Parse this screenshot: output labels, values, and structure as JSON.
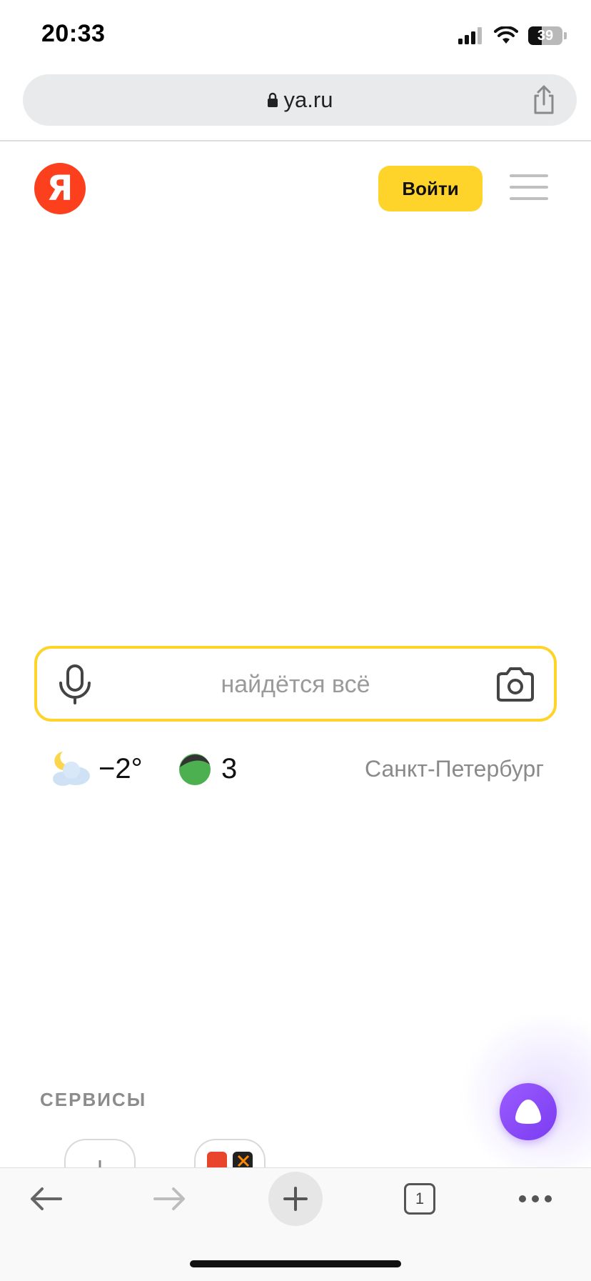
{
  "status_bar": {
    "time": "20:33",
    "battery": "39",
    "battery_level": 0.39
  },
  "address_bar": {
    "url": "ya.ru"
  },
  "header": {
    "logo_letter": "Я",
    "login_label": "Войти"
  },
  "search": {
    "placeholder": "найдётся всё"
  },
  "info": {
    "temperature": "−2°",
    "traffic_score": "3",
    "city": "Санкт-Петербург"
  },
  "services": {
    "title": "СЕРВИСЫ"
  },
  "toolbar": {
    "tabs_count": "1"
  },
  "colors": {
    "brand_red": "#fc3f1d",
    "login_yellow": "#fed42b",
    "alice_purple": "#8a4dff",
    "traffic_green": "#4caf50"
  },
  "icons": [
    "lock-icon",
    "share-icon",
    "menu-icon",
    "microphone-icon",
    "camera-icon",
    "weather-night-cloud-icon",
    "traffic-icon",
    "alice-icon",
    "back-icon",
    "forward-icon",
    "plus-icon",
    "tabs-icon",
    "more-icon"
  ]
}
